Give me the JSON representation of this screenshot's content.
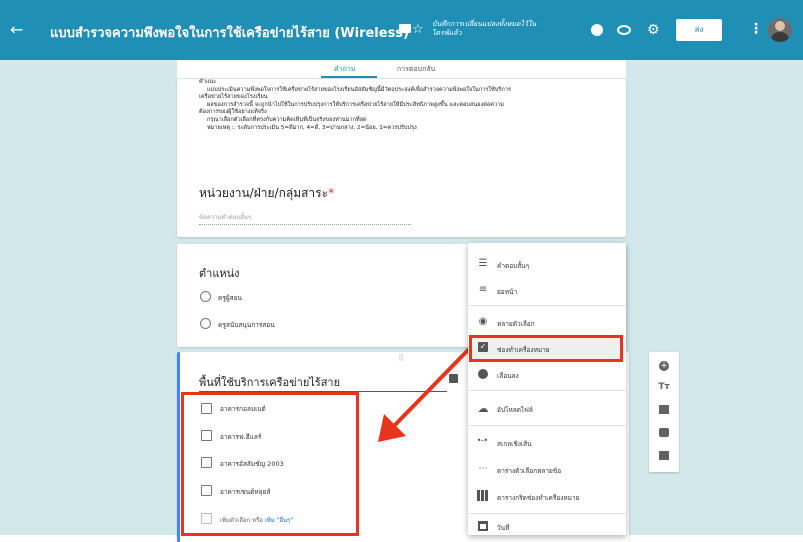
{
  "header": {
    "back_icon": "arrow-left-icon",
    "title": "แบบสำรวจความพึงพอใจในการใช้เครือข่ายไร้สาย (Wireless)",
    "saved_status": "บันทึกการเปลี่ยนแปลงทั้งหมดไว้ในไดรฟ์แล้ว",
    "send_label": "ส่ง",
    "icons": [
      "folder-icon",
      "star-icon",
      "palette-icon",
      "eye-icon",
      "gear-icon",
      "more-vert-icon"
    ],
    "accent_color": "#1f8fb5"
  },
  "tabs": [
    {
      "label": "คำถาม"
    },
    {
      "label": "การตอบกลับ"
    }
  ],
  "description": {
    "lines": [
      "คำแนะ",
      "แบบประเมินความพึงพอใจการใช้เครือข่ายไร้สายของโรงเรียนอัสสัมชัญนี้มีวัตถุประสงค์เพื่อสำรวจความพึงพอใจในการใช้บริการ",
      "เครือข่ายไร้สายของโรงเรียน",
      "ผลของการสำรวจนี้ จะถูกนำไปใช้ในการปรับปรุงการให้บริการเครือข่ายไร้สายให้มีประสิทธิภาพสูงขึ้น และตอบสนองต่อความ",
      "ต้องการของผู้ใช้อย่างแท้จริง",
      "กรุณาเลือกตัวเลือกที่ตรงกับความคิดเห็นที่เป็นจริงของท่านมากที่สุด",
      "หมายเหตุ :: ระดับการประเมิน 5=ดีมาก, 4=ดี, 3=ปานกลาง, 2=น้อย, 1=ควรปรับปรุง"
    ]
  },
  "question1": {
    "title": "หน่วยงาน/ฝ่าย/กลุ่มสาระ",
    "required_mark": "*",
    "answer_placeholder": "ข้อความคำตอบสั้นๆ"
  },
  "question2": {
    "title": "ตำแหน่ง",
    "options": [
      "ครูผู้สอน",
      "ครูสนับสนุนการสอน"
    ]
  },
  "question3": {
    "drag_handle": "⠿",
    "title": "พื้นที่ใช้บริการเครือข่ายไร้สาย",
    "options": [
      "อาคารกอลมเบต์",
      "อาคารฟ.ฮีแลร์",
      "อาคารอัสสัมชัญ 2003",
      "อาคารเซนต์หลุยส์"
    ],
    "add_option": "เพิ่มตัวเลือก",
    "or": "หรือ",
    "add_other": "เพิ่ม \"อื่นๆ\""
  },
  "type_menu": {
    "items": [
      {
        "icon": "short-text-icon",
        "label": "คำตอบสั้นๆ"
      },
      {
        "icon": "paragraph-icon",
        "label": "ย่อหน้า"
      },
      {
        "icon": "radio-button-icon",
        "label": "หลายตัวเลือก"
      },
      {
        "icon": "checkbox-icon",
        "label": "ช่องทำเครื่องหมาย"
      },
      {
        "icon": "dropdown-icon",
        "label": "เลื่อนลง"
      },
      {
        "icon": "cloud-upload-icon",
        "label": "อัปโหลดไฟล์"
      },
      {
        "icon": "linear-scale-icon",
        "label": "สเกลเชิงเส้น"
      },
      {
        "icon": "grid-dots-icon",
        "label": "ตารางตัวเลือกหลายข้อ"
      },
      {
        "icon": "grid-checkbox-icon",
        "label": "ตารางกริดช่องทำเครื่องหมาย"
      },
      {
        "icon": "calendar-icon",
        "label": "วันที่"
      }
    ],
    "selected_index": 3
  },
  "side_toolbar": [
    "add-question-icon",
    "add-title-icon",
    "add-image-icon",
    "add-video-icon",
    "add-section-icon"
  ],
  "highlight_color": "#e8341b"
}
